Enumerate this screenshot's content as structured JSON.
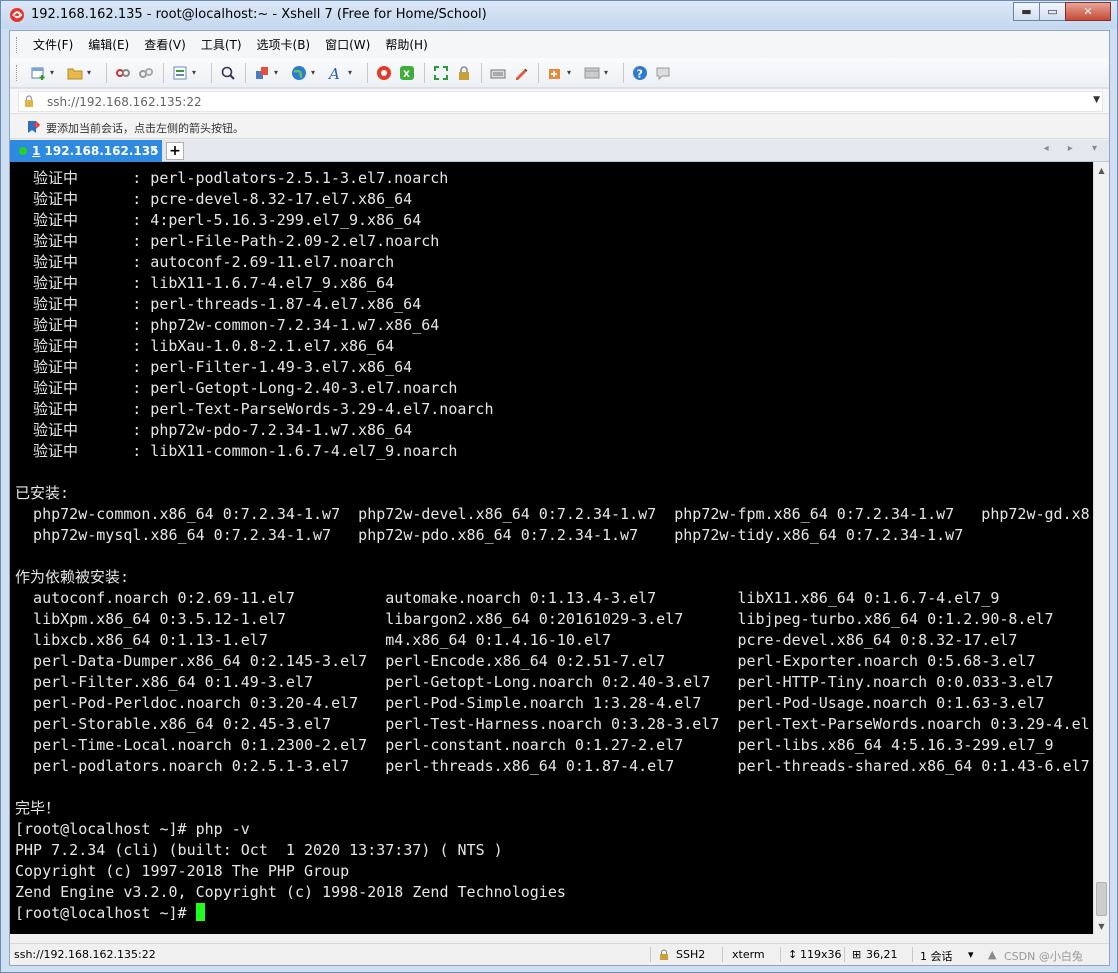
{
  "window": {
    "title": "192.168.162.135 - root@localhost:~ - Xshell 7 (Free for Home/School)",
    "buttons": {
      "minimize": "▬",
      "maximize": "▭",
      "close": "✕"
    }
  },
  "menu": {
    "items": [
      "文件(F)",
      "编辑(E)",
      "查看(V)",
      "工具(T)",
      "选项卡(B)",
      "窗口(W)",
      "帮助(H)"
    ]
  },
  "toolbar": {
    "icons": [
      "new-session-icon",
      "open-folder-icon",
      "disconnect-icon",
      "reconnect-icon",
      "properties-icon",
      "find-icon",
      "transfer-icon",
      "globe-icon",
      "font-icon",
      "xftp-icon",
      "xmanager-icon",
      "fullscreen-icon",
      "lock-icon",
      "keyboard-icon",
      "highlight-icon",
      "compose-icon",
      "layout-icon",
      "help-icon",
      "chat-icon"
    ]
  },
  "address": {
    "value": "ssh://192.168.162.135:22"
  },
  "hint": {
    "text": "要添加当前会话，点击左侧的箭头按钮。"
  },
  "tabs": {
    "active": {
      "number": "1",
      "label": "192.168.162.135",
      "close": "×"
    },
    "add": "+",
    "nav": "◂ ▸ ▾"
  },
  "terminal": {
    "lines": [
      "  验证中      : perl-podlators-2.5.1-3.el7.noarch",
      "  验证中      : pcre-devel-8.32-17.el7.x86_64",
      "  验证中      : 4:perl-5.16.3-299.el7_9.x86_64",
      "  验证中      : perl-File-Path-2.09-2.el7.noarch",
      "  验证中      : autoconf-2.69-11.el7.noarch",
      "  验证中      : libX11-1.6.7-4.el7_9.x86_64",
      "  验证中      : perl-threads-1.87-4.el7.x86_64",
      "  验证中      : php72w-common-7.2.34-1.w7.x86_64",
      "  验证中      : libXau-1.0.8-2.1.el7.x86_64",
      "  验证中      : perl-Filter-1.49-3.el7.x86_64",
      "  验证中      : perl-Getopt-Long-2.40-3.el7.noarch",
      "  验证中      : perl-Text-ParseWords-3.29-4.el7.noarch",
      "  验证中      : php72w-pdo-7.2.34-1.w7.x86_64",
      "  验证中      : libX11-common-1.6.7-4.el7_9.noarch",
      "",
      "已安装:",
      "  php72w-common.x86_64 0:7.2.34-1.w7  php72w-devel.x86_64 0:7.2.34-1.w7  php72w-fpm.x86_64 0:7.2.34-1.w7   php72w-gd.x8",
      "  php72w-mysql.x86_64 0:7.2.34-1.w7   php72w-pdo.x86_64 0:7.2.34-1.w7    php72w-tidy.x86_64 0:7.2.34-1.w7",
      "",
      "作为依赖被安装:",
      "  autoconf.noarch 0:2.69-11.el7          automake.noarch 0:1.13.4-3.el7         libX11.x86_64 0:1.6.7-4.el7_9",
      "  libXpm.x86_64 0:3.5.12-1.el7           libargon2.x86_64 0:20161029-3.el7      libjpeg-turbo.x86_64 0:1.2.90-8.el7",
      "  libxcb.x86_64 0:1.13-1.el7             m4.x86_64 0:1.4.16-10.el7              pcre-devel.x86_64 0:8.32-17.el7",
      "  perl-Data-Dumper.x86_64 0:2.145-3.el7  perl-Encode.x86_64 0:2.51-7.el7        perl-Exporter.noarch 0:5.68-3.el7",
      "  perl-Filter.x86_64 0:1.49-3.el7        perl-Getopt-Long.noarch 0:2.40-3.el7   perl-HTTP-Tiny.noarch 0:0.033-3.el7",
      "  perl-Pod-Perldoc.noarch 0:3.20-4.el7   perl-Pod-Simple.noarch 1:3.28-4.el7    perl-Pod-Usage.noarch 0:1.63-3.el7",
      "  perl-Storable.x86_64 0:2.45-3.el7      perl-Test-Harness.noarch 0:3.28-3.el7  perl-Text-ParseWords.noarch 0:3.29-4.el",
      "  perl-Time-Local.noarch 0:1.2300-2.el7  perl-constant.noarch 0:1.27-2.el7      perl-libs.x86_64 4:5.16.3-299.el7_9",
      "  perl-podlators.noarch 0:2.5.1-3.el7    perl-threads.x86_64 0:1.87-4.el7       perl-threads-shared.x86_64 0:1.43-6.el7",
      "",
      "完毕！",
      "[root@localhost ~]# php -v",
      "PHP 7.2.34 (cli) (built: Oct  1 2020 13:37:37) ( NTS )",
      "Copyright (c) 1997-2018 The PHP Group",
      "Zend Engine v3.2.0, Copyright (c) 1998-2018 Zend Technologies"
    ],
    "prompt": "[root@localhost ~]# ",
    "cursor_color": "#1eff1e"
  },
  "status": {
    "address": "ssh://192.168.162.135:22",
    "protocol": "SSH2",
    "terminal_type": "xterm",
    "size": "119x36",
    "position": "36,21",
    "sessions": "1 会话",
    "watermark": "CSDN @小白兔"
  }
}
